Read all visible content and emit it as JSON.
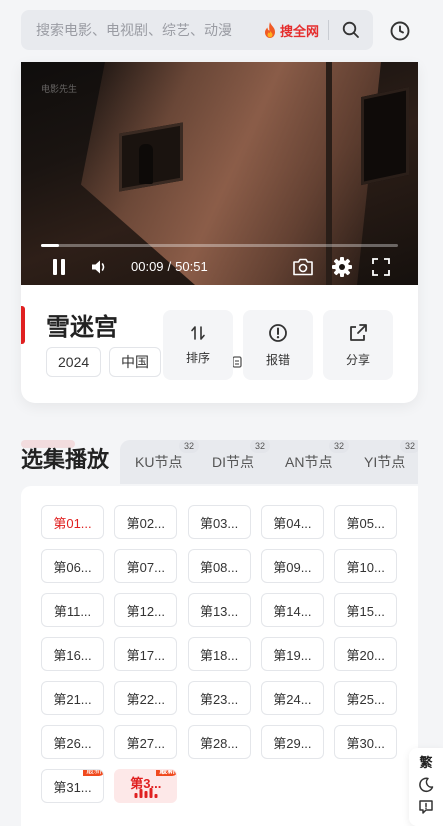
{
  "search": {
    "placeholder": "搜索电影、电视剧、综艺、动漫",
    "all_label": "搜全网"
  },
  "player": {
    "watermark": "电影先生",
    "current_time": "00:09",
    "separator": "/",
    "duration": "50:51",
    "progress": 0.05
  },
  "movie": {
    "title": "雪迷宫",
    "tags": [
      "2024",
      "中国"
    ]
  },
  "actions": [
    {
      "label": "排序",
      "icon": "sort-icon"
    },
    {
      "label": "报错",
      "icon": "alert-circle-icon"
    },
    {
      "label": "分享",
      "icon": "share-icon"
    }
  ],
  "episodes_section": {
    "title": "选集播放",
    "nodes": [
      {
        "label": "KU节点",
        "count": "32"
      },
      {
        "label": "DI节点",
        "count": "32"
      },
      {
        "label": "AN节点",
        "count": "32"
      },
      {
        "label": "YI节点",
        "count": "32"
      }
    ],
    "episodes": [
      "第01...",
      "第02...",
      "第03...",
      "第04...",
      "第05...",
      "第06...",
      "第07...",
      "第08...",
      "第09...",
      "第10...",
      "第11...",
      "第12...",
      "第13...",
      "第14...",
      "第15...",
      "第16...",
      "第17...",
      "第18...",
      "第19...",
      "第20...",
      "第21...",
      "第22...",
      "第23...",
      "第24...",
      "第25...",
      "第26...",
      "第27...",
      "第28...",
      "第29...",
      "第30...",
      "第31...",
      "第3..."
    ],
    "new_badge": "最新"
  },
  "float": {
    "traditional": "繁"
  }
}
